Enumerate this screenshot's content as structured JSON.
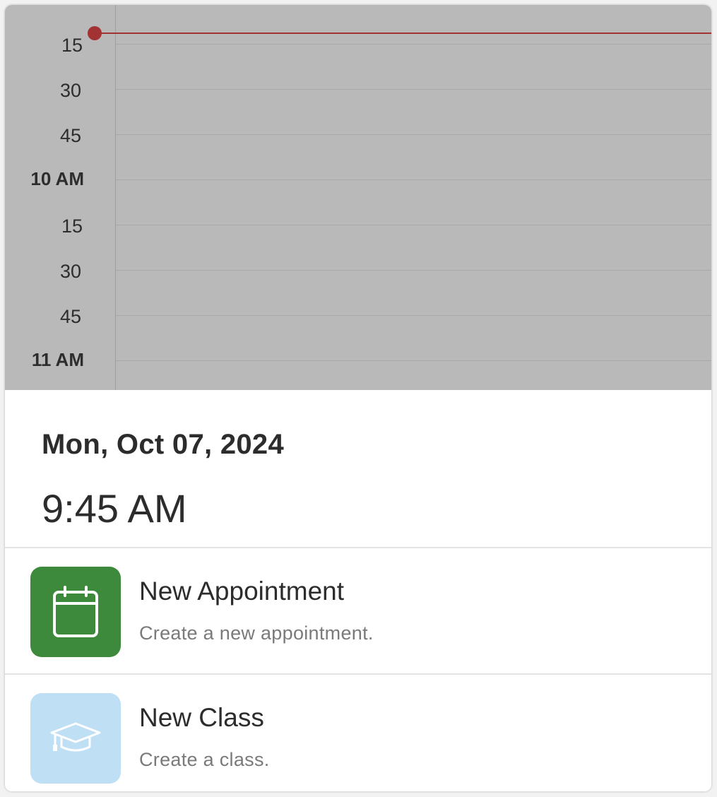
{
  "calendar": {
    "time_labels": [
      {
        "text": "15",
        "hour": false
      },
      {
        "text": "30",
        "hour": false
      },
      {
        "text": "45",
        "hour": false
      },
      {
        "text": "10 AM",
        "hour": true
      },
      {
        "text": "15",
        "hour": false
      },
      {
        "text": "30",
        "hour": false
      },
      {
        "text": "45",
        "hour": false
      },
      {
        "text": "11 AM",
        "hour": true
      }
    ],
    "now_indicator_color": "#a33333"
  },
  "sheet": {
    "date": "Mon, Oct 07, 2024",
    "time": "9:45 AM",
    "actions": [
      {
        "title": "New Appointment",
        "subtitle": "Create a new appointment.",
        "icon": "calendar-icon",
        "icon_bg": "#3d8a3c"
      },
      {
        "title": "New Class",
        "subtitle": "Create a class.",
        "icon": "graduation-cap-icon",
        "icon_bg": "#bfdff5"
      }
    ]
  }
}
